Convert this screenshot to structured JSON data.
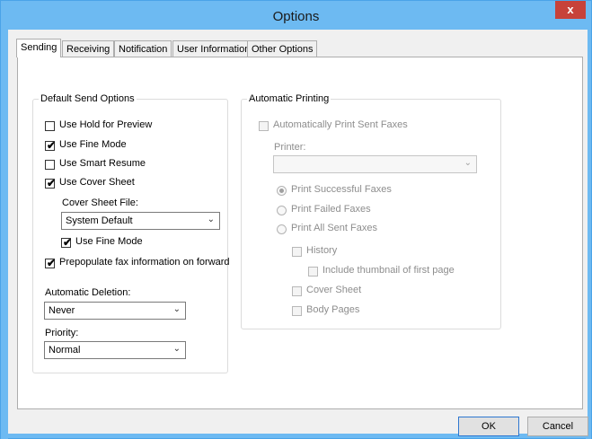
{
  "window": {
    "title": "Options",
    "close_glyph": "x"
  },
  "tabs": [
    "Sending",
    "Receiving",
    "Notification",
    "User Information",
    "Other Options"
  ],
  "default_send": {
    "legend": "Default Send Options",
    "use_hold_for_preview": {
      "label": "Use Hold for Preview",
      "checked": false
    },
    "use_fine_mode": {
      "label": "Use Fine Mode",
      "checked": true
    },
    "use_smart_resume": {
      "label": "Use Smart Resume",
      "checked": false
    },
    "use_cover_sheet": {
      "label": "Use Cover Sheet",
      "checked": true
    },
    "cover_sheet_file_label": "Cover Sheet File:",
    "cover_sheet_file_value": "System Default",
    "cover_use_fine_mode": {
      "label": "Use Fine Mode",
      "checked": true
    },
    "prepopulate": {
      "label": "Prepopulate fax information on forward",
      "checked": true
    },
    "automatic_deletion_label": "Automatic Deletion:",
    "automatic_deletion_value": "Never",
    "priority_label": "Priority:",
    "priority_value": "Normal"
  },
  "auto_printing": {
    "legend": "Automatic Printing",
    "auto_print": {
      "label": "Automatically Print Sent Faxes",
      "checked": false
    },
    "printer_label": "Printer:",
    "printer_value": "",
    "options": [
      "Print Successful Faxes",
      "Print Failed Faxes",
      "Print All Sent Faxes"
    ],
    "selected_option": "Print Successful Faxes",
    "history": {
      "label": "History",
      "checked": false
    },
    "include_thumbnail": {
      "label": "Include thumbnail of first page",
      "checked": false
    },
    "cover_sheet": {
      "label": "Cover Sheet",
      "checked": false
    },
    "body_pages": {
      "label": "Body Pages",
      "checked": false
    }
  },
  "buttons": {
    "ok": "OK",
    "cancel": "Cancel"
  },
  "glyphs": {
    "check": "✔",
    "chevron": "⌄"
  },
  "colors": {
    "title_bar": "#6dbaf2",
    "close": "#c7423a",
    "default_button_border": "#2e77d0"
  }
}
